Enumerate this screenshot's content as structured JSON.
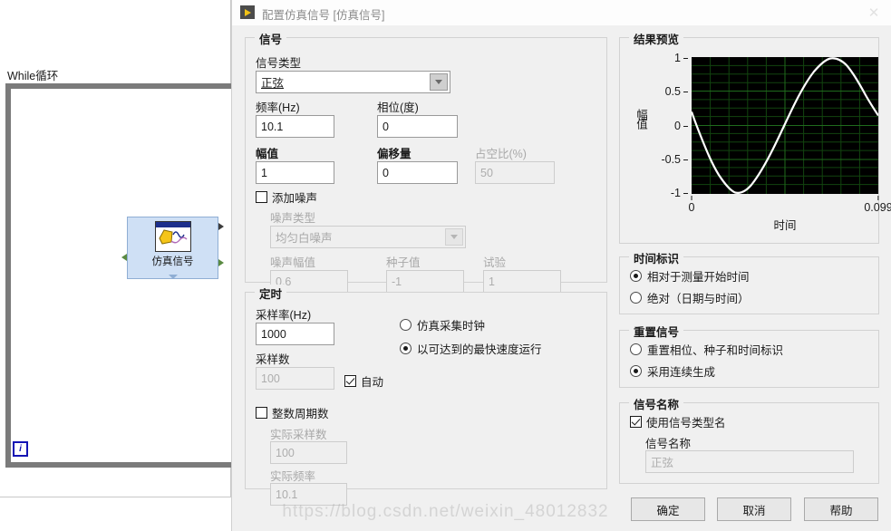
{
  "background": {
    "while_loop_label": "While循环",
    "iteration_terminal": "i",
    "express_vi_label": "仿真信号"
  },
  "dialog": {
    "title": "配置仿真信号 [仿真信号]",
    "close_label": "✕"
  },
  "signal_group": {
    "title": "信号",
    "signal_type_label": "信号类型",
    "signal_type_value": "正弦",
    "frequency_label": "频率(Hz)",
    "frequency_value": "10.1",
    "phase_label": "相位(度)",
    "phase_value": "0",
    "amplitude_label": "幅值",
    "amplitude_value": "1",
    "offset_label": "偏移量",
    "offset_value": "0",
    "duty_label": "占空比(%)",
    "duty_value": "50",
    "add_noise_label": "添加噪声",
    "add_noise_checked": false,
    "noise_type_label": "噪声类型",
    "noise_type_value": "均匀白噪声",
    "noise_amp_label": "噪声幅值",
    "noise_amp_value": "0.6",
    "seed_label": "种子值",
    "seed_value": "-1",
    "trial_label": "试验",
    "trial_value": "1"
  },
  "timing_group": {
    "title": "定时",
    "sample_rate_label": "采样率(Hz)",
    "sample_rate_value": "1000",
    "samples_label": "采样数",
    "samples_value": "100",
    "auto_label": "自动",
    "auto_checked": true,
    "integer_cycles_label": "整数周期数",
    "integer_cycles_checked": false,
    "actual_samples_label": "实际采样数",
    "actual_samples_value": "100",
    "actual_freq_label": "实际频率",
    "actual_freq_value": "10.1",
    "radio_sim_clock": "仿真采集时钟",
    "radio_fastest": "以可达到的最快速度运行",
    "radio_selected": "fastest"
  },
  "preview_group": {
    "title": "结果预览"
  },
  "timestamp_group": {
    "title": "时间标识",
    "relative_label": "相对于测量开始时间",
    "absolute_label": "绝对（日期与时间）",
    "selected": "relative"
  },
  "reset_group": {
    "title": "重置信号",
    "reset_label": "重置相位、种子和时间标识",
    "continuous_label": "采用连续生成",
    "selected": "continuous"
  },
  "name_group": {
    "title": "信号名称",
    "use_type_name_label": "使用信号类型名",
    "use_type_name_checked": true,
    "signal_name_label": "信号名称",
    "signal_name_value": "正弦"
  },
  "buttons": {
    "ok": "确定",
    "cancel": "取消",
    "help": "帮助"
  },
  "watermark": "https://blog.csdn.net/weixin_48012832",
  "chart_data": {
    "type": "line",
    "title": "结果预览",
    "xlabel": "时间",
    "ylabel": "幅值",
    "xlim": [
      0,
      0.099
    ],
    "ylim": [
      -1,
      1
    ],
    "xticks": [
      "0",
      "0.099"
    ],
    "yticks": [
      "1",
      "0.5",
      "0",
      "-0.5",
      "-1"
    ],
    "grid": true,
    "grid_color": "#1d5a1d",
    "plot_background": "#000000",
    "trace_color": "#ffffff",
    "series": [
      {
        "name": "正弦",
        "frequency_hz": 10.1,
        "amplitude": 1,
        "phase_deg": 0,
        "offset": 0,
        "samples": 100,
        "sample_rate_hz": 1000
      }
    ]
  }
}
